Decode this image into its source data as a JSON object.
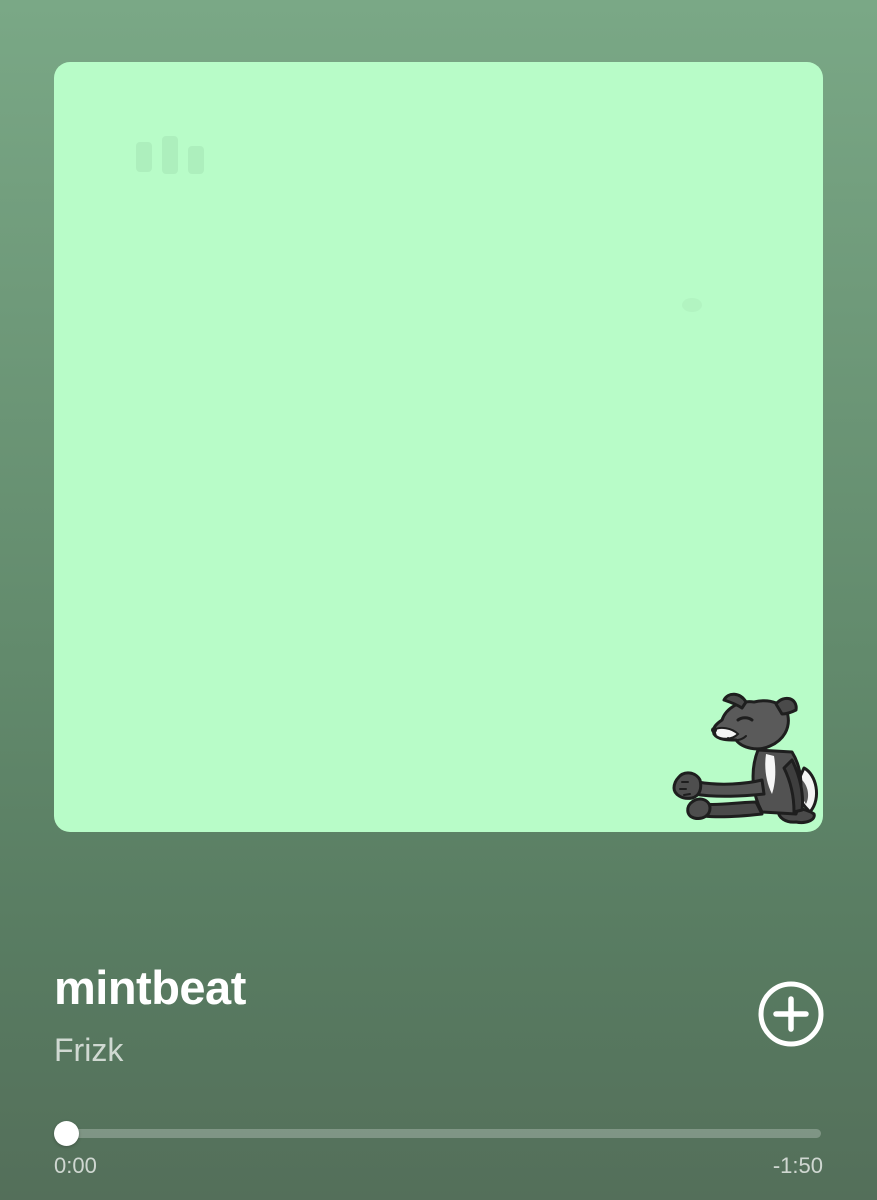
{
  "track": {
    "title": "mintbeat",
    "artist": "Frizk"
  },
  "artwork": {
    "background_color": "#b8fcc8",
    "character_icon": "wolf-character-sitting"
  },
  "actions": {
    "add_icon": "plus-circle-icon"
  },
  "playback": {
    "elapsed": "0:00",
    "remaining": "-1:50",
    "progress": 0.0
  },
  "colors": {
    "background_top": "#7aa886",
    "background_bottom": "#546f5a",
    "foreground": "#ffffff"
  }
}
